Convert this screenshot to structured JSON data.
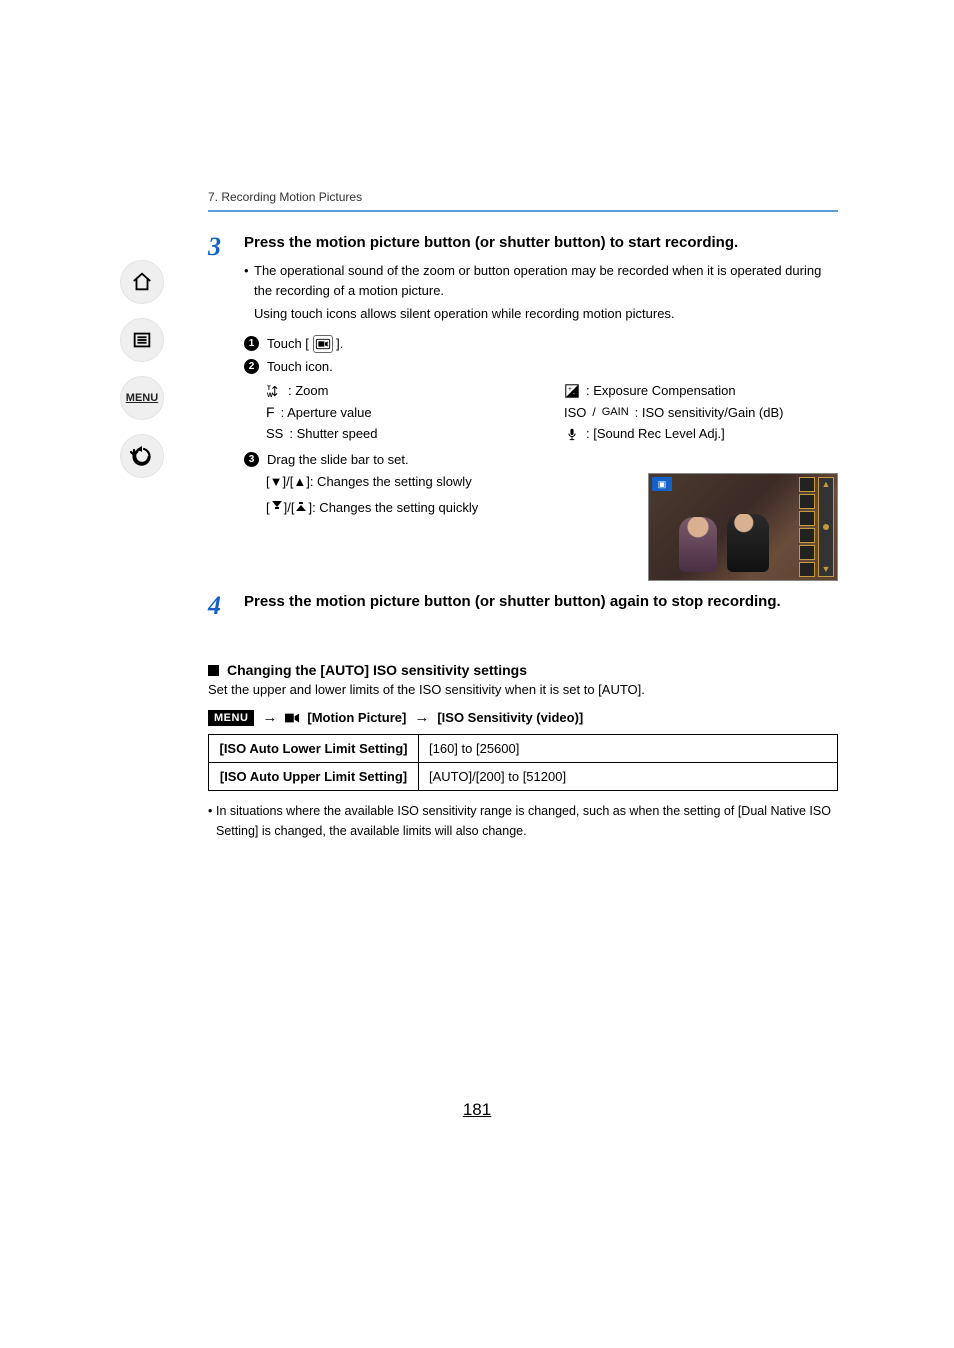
{
  "chapter": "7. Recording Motion Pictures",
  "nav": {
    "menu_label": "MENU"
  },
  "step3": {
    "num": "3",
    "title": "Press the motion picture button (or shutter button) to start recording.",
    "bullet1": "The operational sound of the zoom or button operation may be recorded when it is operated during the recording of a motion picture.",
    "bullet1b": "Using touch icons allows silent operation while recording motion pictures.",
    "sub1_a": "Touch [",
    "sub1_b": "].",
    "sub2": "Touch icon.",
    "zoom_label": ": Zoom",
    "aperture_sym": "F",
    "aperture_label": " : Aperture value",
    "shutter_sym": "SS",
    "shutter_label": " : Shutter speed",
    "exp_label": ": Exposure Compensation",
    "iso_sym": "ISO",
    "gain_sym": "GAIN",
    "iso_label": ": ISO sensitivity/Gain (dB)",
    "sound_label": " : [Sound Rec Level Adj.]",
    "sub3": "Drag the slide bar to set.",
    "slow_a": "[",
    "slow_mid": "]/[",
    "slow_b": "]: Changes the setting slowly",
    "fast_a": "[",
    "fast_mid": "]/[",
    "fast_b": "]: Changes the setting quickly"
  },
  "step4": {
    "num": "4",
    "title": "Press the motion picture button (or shutter button) again to stop recording."
  },
  "iso_section": {
    "title": "Changing the [AUTO] ISO sensitivity settings",
    "desc": "Set the upper and lower limits of the ISO sensitivity when it is set to [AUTO].",
    "menu_label": "MENU",
    "path1": "[Motion Picture]",
    "path2": "[ISO Sensitivity (video)]",
    "row1_k": "[ISO Auto Lower Limit Setting]",
    "row1_v": "[160] to [25600]",
    "row2_k": "[ISO Auto Upper Limit Setting]",
    "row2_v": "[AUTO]/[200] to [51200]",
    "note": "In situations where the available ISO sensitivity range is changed, such as when the setting of [Dual Native ISO Setting] is changed, the available limits will also change."
  },
  "page_number": "181"
}
